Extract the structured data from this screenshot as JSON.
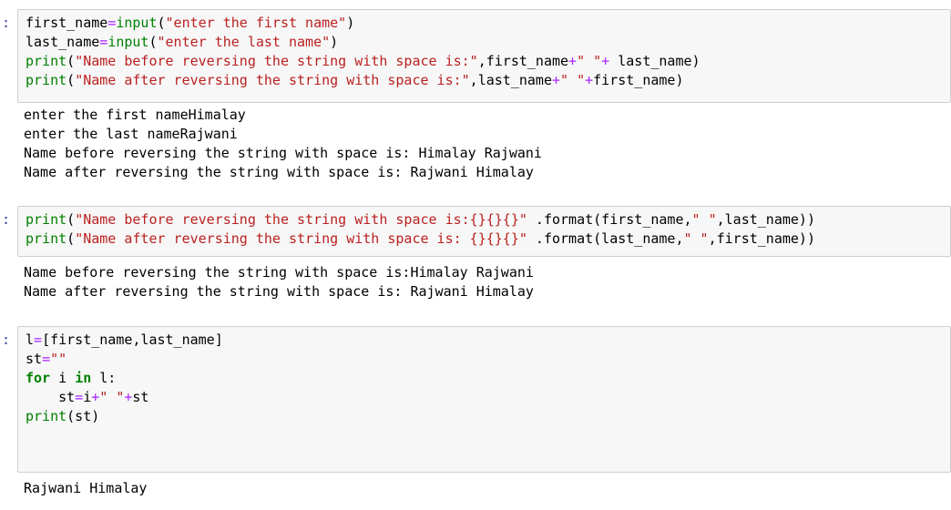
{
  "cells": [
    {
      "prompt": ":",
      "code": [
        [
          {
            "t": "first_name",
            "c": "plain"
          },
          {
            "t": "=",
            "c": "op"
          },
          {
            "t": "input",
            "c": "builtin"
          },
          {
            "t": "(",
            "c": "plain"
          },
          {
            "t": "\"enter the first name\"",
            "c": "str"
          },
          {
            "t": ")",
            "c": "plain"
          }
        ],
        [
          {
            "t": "last_name",
            "c": "plain"
          },
          {
            "t": "=",
            "c": "op"
          },
          {
            "t": "input",
            "c": "builtin"
          },
          {
            "t": "(",
            "c": "plain"
          },
          {
            "t": "\"enter the last name\"",
            "c": "str"
          },
          {
            "t": ")",
            "c": "plain"
          }
        ],
        [
          {
            "t": "print",
            "c": "builtin"
          },
          {
            "t": "(",
            "c": "plain"
          },
          {
            "t": "\"Name before reversing the string with space is:\"",
            "c": "str"
          },
          {
            "t": ",first_name",
            "c": "plain"
          },
          {
            "t": "+",
            "c": "op"
          },
          {
            "t": "\" \"",
            "c": "str"
          },
          {
            "t": "+",
            "c": "op"
          },
          {
            "t": " last_name)",
            "c": "plain"
          }
        ],
        [
          {
            "t": "print",
            "c": "builtin"
          },
          {
            "t": "(",
            "c": "plain"
          },
          {
            "t": "\"Name after reversing the string with space is:\"",
            "c": "str"
          },
          {
            "t": ",last_name",
            "c": "plain"
          },
          {
            "t": "+",
            "c": "op"
          },
          {
            "t": "\" \"",
            "c": "str"
          },
          {
            "t": "+",
            "c": "op"
          },
          {
            "t": "first_name)",
            "c": "plain"
          }
        ]
      ],
      "output": [
        "enter the first nameHimalay",
        "enter the last nameRajwani",
        "Name before reversing the string with space is: Himalay Rajwani",
        "Name after reversing the string with space is: Rajwani Himalay"
      ]
    },
    {
      "prompt": ":",
      "code": [
        [
          {
            "t": "print",
            "c": "builtin"
          },
          {
            "t": "(",
            "c": "plain"
          },
          {
            "t": "\"Name before reversing the string with space is:{}{}{}\"",
            "c": "str"
          },
          {
            "t": " .format(first_name,",
            "c": "plain"
          },
          {
            "t": "\" \"",
            "c": "str"
          },
          {
            "t": ",last_name))",
            "c": "plain"
          }
        ],
        [
          {
            "t": "print",
            "c": "builtin"
          },
          {
            "t": "(",
            "c": "plain"
          },
          {
            "t": "\"Name after reversing the string with space is: {}{}{}\"",
            "c": "str"
          },
          {
            "t": " .format(last_name,",
            "c": "plain"
          },
          {
            "t": "\" \"",
            "c": "str"
          },
          {
            "t": ",first_name))",
            "c": "plain"
          }
        ]
      ],
      "output": [
        "Name before reversing the string with space is:Himalay Rajwani",
        "Name after reversing the string with space is: Rajwani Himalay"
      ]
    },
    {
      "prompt": ":",
      "code": [
        [
          {
            "t": "l",
            "c": "plain"
          },
          {
            "t": "=",
            "c": "op"
          },
          {
            "t": "[first_name,last_name]",
            "c": "plain"
          }
        ],
        [
          {
            "t": "st",
            "c": "plain"
          },
          {
            "t": "=",
            "c": "op"
          },
          {
            "t": "\"\"",
            "c": "str"
          }
        ],
        [
          {
            "t": "for",
            "c": "kw"
          },
          {
            "t": " i ",
            "c": "plain"
          },
          {
            "t": "in",
            "c": "kw"
          },
          {
            "t": " l:",
            "c": "plain"
          }
        ],
        [
          {
            "t": "    st",
            "c": "plain"
          },
          {
            "t": "=",
            "c": "op"
          },
          {
            "t": "i",
            "c": "plain"
          },
          {
            "t": "+",
            "c": "op"
          },
          {
            "t": "\" \"",
            "c": "str"
          },
          {
            "t": "+",
            "c": "op"
          },
          {
            "t": "st",
            "c": "plain"
          }
        ],
        [
          {
            "t": "print",
            "c": "builtin"
          },
          {
            "t": "(st)",
            "c": "plain"
          }
        ],
        [],
        []
      ],
      "output": [
        "Rajwani Himalay"
      ]
    }
  ]
}
